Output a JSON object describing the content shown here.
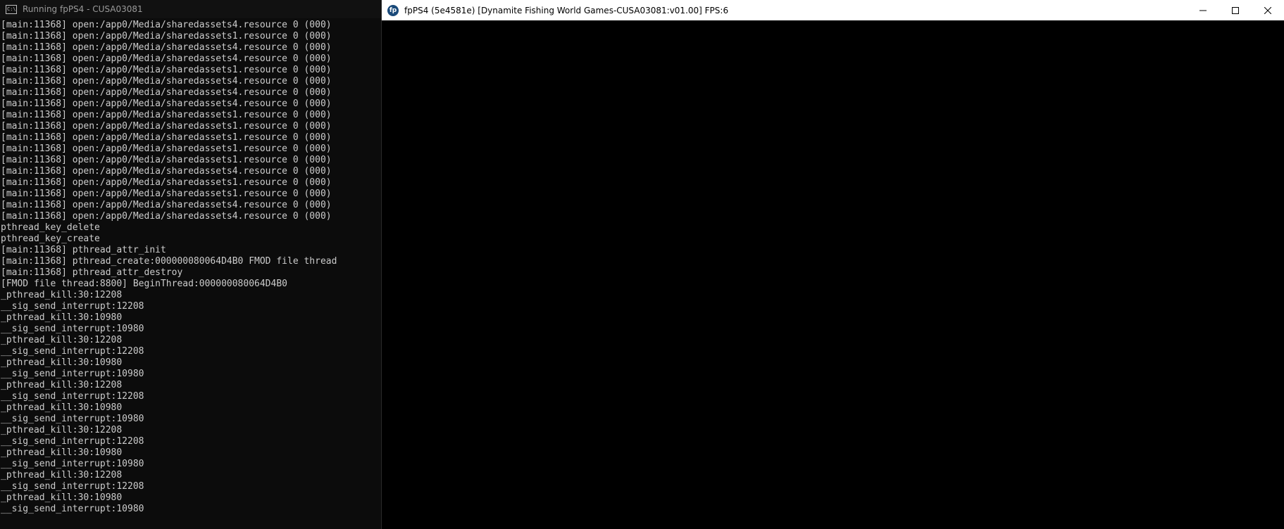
{
  "console": {
    "title": "Running fpPS4 - CUSA03081",
    "icon": "console-app-icon",
    "icon_text": "C:\\",
    "lines": [
      "[main:11368] open:/app0/Media/sharedassets4.resource 0 (000)",
      "[main:11368] open:/app0/Media/sharedassets1.resource 0 (000)",
      "[main:11368] open:/app0/Media/sharedassets4.resource 0 (000)",
      "[main:11368] open:/app0/Media/sharedassets4.resource 0 (000)",
      "[main:11368] open:/app0/Media/sharedassets1.resource 0 (000)",
      "[main:11368] open:/app0/Media/sharedassets4.resource 0 (000)",
      "[main:11368] open:/app0/Media/sharedassets4.resource 0 (000)",
      "[main:11368] open:/app0/Media/sharedassets4.resource 0 (000)",
      "[main:11368] open:/app0/Media/sharedassets1.resource 0 (000)",
      "[main:11368] open:/app0/Media/sharedassets1.resource 0 (000)",
      "[main:11368] open:/app0/Media/sharedassets1.resource 0 (000)",
      "[main:11368] open:/app0/Media/sharedassets1.resource 0 (000)",
      "[main:11368] open:/app0/Media/sharedassets1.resource 0 (000)",
      "[main:11368] open:/app0/Media/sharedassets4.resource 0 (000)",
      "[main:11368] open:/app0/Media/sharedassets1.resource 0 (000)",
      "[main:11368] open:/app0/Media/sharedassets1.resource 0 (000)",
      "[main:11368] open:/app0/Media/sharedassets4.resource 0 (000)",
      "[main:11368] open:/app0/Media/sharedassets4.resource 0 (000)",
      "pthread_key_delete",
      "pthread_key_create",
      "[main:11368] pthread_attr_init",
      "[main:11368] pthread_create:000000080064D4B0 FMOD file thread",
      "[main:11368] pthread_attr_destroy",
      "[FMOD file thread:8800] BeginThread:000000080064D4B0",
      "_pthread_kill:30:12208",
      "__sig_send_interrupt:12208",
      "_pthread_kill:30:10980",
      "__sig_send_interrupt:10980",
      "_pthread_kill:30:12208",
      "__sig_send_interrupt:12208",
      "_pthread_kill:30:10980",
      "__sig_send_interrupt:10980",
      "_pthread_kill:30:12208",
      "__sig_send_interrupt:12208",
      "_pthread_kill:30:10980",
      "__sig_send_interrupt:10980",
      "_pthread_kill:30:12208",
      "__sig_send_interrupt:12208",
      "_pthread_kill:30:10980",
      "__sig_send_interrupt:10980",
      "_pthread_kill:30:12208",
      "__sig_send_interrupt:12208",
      "_pthread_kill:30:10980",
      "__sig_send_interrupt:10980"
    ]
  },
  "emulator": {
    "title": "fpPS4 (5e4581e) [Dynamite Fishing World Games-CUSA03081:v01.00] FPS:6",
    "icon": "fpps4-app-icon",
    "icon_text": "fp",
    "controls": {
      "minimize": "minimize-icon",
      "maximize": "maximize-icon",
      "close": "close-icon"
    }
  }
}
